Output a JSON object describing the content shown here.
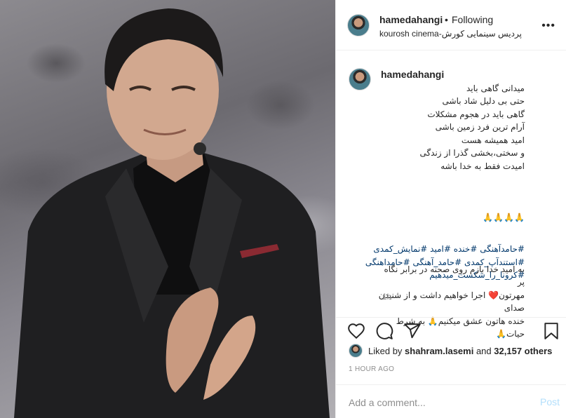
{
  "post": {
    "username": "hamedahangi",
    "separator": "•",
    "follow_status": "Following",
    "location": "kourosh cinema-پردیس سینمایی کورش",
    "caption_lines": "میدانی گاهی باید\nحتی بی دلیل شاد باشی\nگاهی باید در هجوم مشکلات\nآرام ترین فرد زمین باشی\nامید همیشه هست\nو سختی،بخشی گذرا از زندگی\nامیدت فقط به خدا باشه",
    "emoji_line": "🙏🙏🙏🙏",
    "caption_para2": "به امید خدا بازم روی صحنه در برابر نگاه پر\nمهرتون❤️ اجرا خواهیم داشت و از شنیدن صدای\nخنده هاتون عشق میکنیم🙏 به شرط حیات🙏",
    "hashtags": "#حامدآهنگی #خنده #امید #نمایش_کمدی\n#استندآپ_کمدی #حامد_آهنگی #حامداهنگی\n#کرونا_را_شکست_میدهیم",
    "time_ago": "1h"
  },
  "likes": {
    "prefix": "Liked by",
    "user": "shahram.lasemi",
    "and": "and",
    "count": "32,157 others"
  },
  "timestamp": "1 HOUR AGO",
  "comment": {
    "placeholder": "Add a comment...",
    "post_label": "Post"
  },
  "colors": {
    "link": "#00376b",
    "muted": "#8e8e8e",
    "post_disabled": "#b2dffc",
    "border": "#efefef"
  }
}
